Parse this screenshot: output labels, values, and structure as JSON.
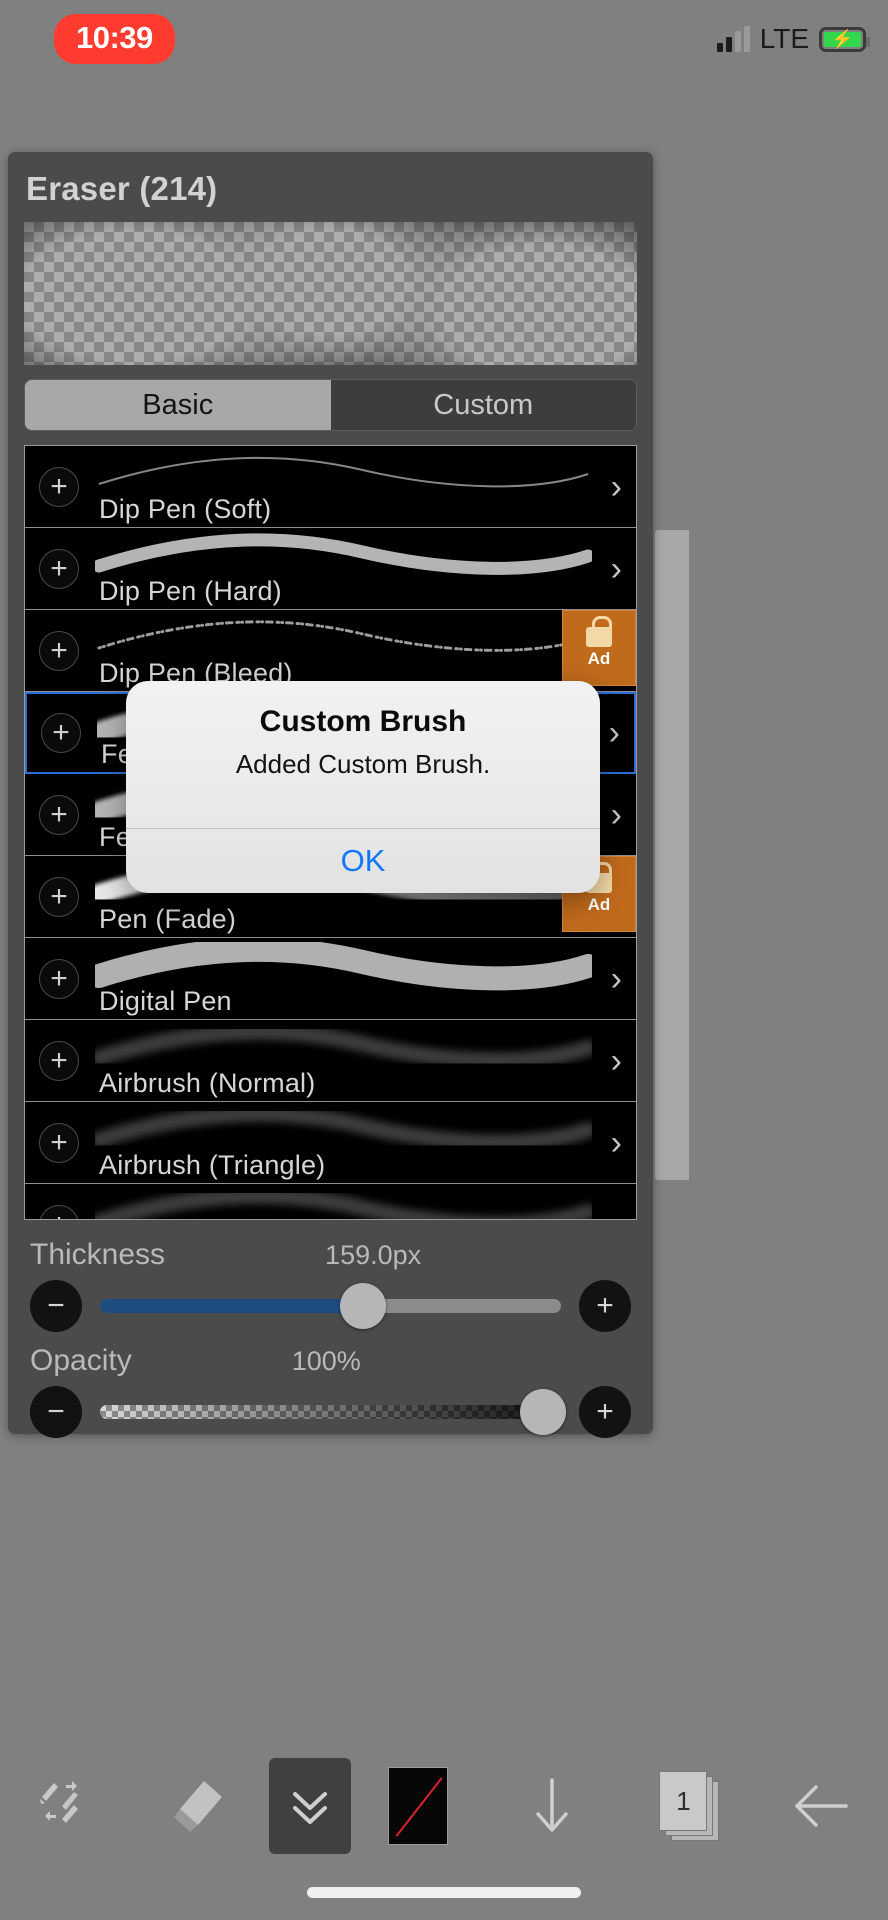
{
  "status_bar": {
    "time": "10:39",
    "network": "LTE",
    "signal_icon": "signal-bars-icon",
    "battery_icon": "battery-charging-icon",
    "time_pill_color": "#ff3b30",
    "battery_color": "#32d74b"
  },
  "panel": {
    "title": "Eraser (214)",
    "preview_name": "brush-preview",
    "segmented": {
      "options": [
        {
          "label": "Basic",
          "selected": true
        },
        {
          "label": "Custom",
          "selected": false
        }
      ]
    },
    "brushes": [
      {
        "name": "Dip Pen (Soft)",
        "locked": false,
        "selected": false,
        "stroke": "thin-soft"
      },
      {
        "name": "Dip Pen (Hard)",
        "locked": false,
        "selected": false,
        "stroke": "thick-hard"
      },
      {
        "name": "Dip Pen (Bleed)",
        "locked": true,
        "selected": false,
        "stroke": "speckle"
      },
      {
        "name": "Felt Tip Pen (Soft)",
        "locked": false,
        "selected": true,
        "stroke": "soft-wide"
      },
      {
        "name": "Felt Tip Pen (Hard)",
        "locked": false,
        "selected": false,
        "stroke": "soft-wide"
      },
      {
        "name": "Pen (Fade)",
        "locked": true,
        "selected": false,
        "stroke": "fade"
      },
      {
        "name": "Digital Pen",
        "locked": false,
        "selected": false,
        "stroke": "solid-wide"
      },
      {
        "name": "Airbrush (Normal)",
        "locked": false,
        "selected": false,
        "stroke": "airbrush"
      },
      {
        "name": "Airbrush (Triangle)",
        "locked": false,
        "selected": false,
        "stroke": "airbrush"
      },
      {
        "name": "",
        "locked": false,
        "selected": false,
        "stroke": "airbrush"
      }
    ],
    "ad_badge": {
      "label": "Ad",
      "icon": "lock-icon",
      "color": "#c06a1c"
    },
    "add_button_icon": "plus-icon",
    "disclosure_icon": "chevron-right-icon",
    "thickness": {
      "label": "Thickness",
      "value": "159.0px",
      "percent": 57,
      "minus_icon": "minus-icon",
      "plus_icon": "plus-icon",
      "fill_color": "#1e4b80"
    },
    "opacity": {
      "label": "Opacity",
      "value": "100%",
      "percent": 96,
      "minus_icon": "minus-icon",
      "plus_icon": "plus-icon"
    }
  },
  "dialog": {
    "title": "Custom Brush",
    "message": "Added Custom Brush.",
    "ok_label": "OK",
    "ok_color": "#1277ff"
  },
  "toolbar": {
    "items": [
      {
        "icon": "pen-eraser-swap-icon",
        "label": ""
      },
      {
        "icon": "eraser-icon",
        "label": ""
      },
      {
        "icon": "double-chevron-down-icon",
        "label": "",
        "active": true
      },
      {
        "icon": "color-swatch-none-icon",
        "label": ""
      },
      {
        "icon": "arrow-down-icon",
        "label": ""
      },
      {
        "icon": "layers-icon",
        "label": "1"
      },
      {
        "icon": "arrow-left-icon",
        "label": ""
      }
    ],
    "layer_count": "1"
  }
}
